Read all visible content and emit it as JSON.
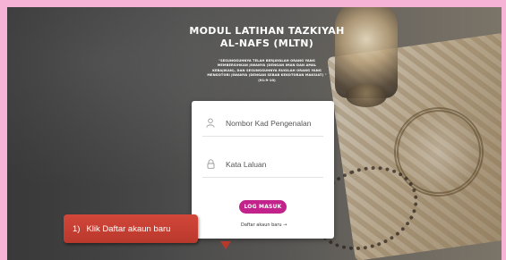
{
  "page": {
    "title_line1": "MODUL LATIHAN TAZKIYAH",
    "title_line2": "AL-NAFS (MLTN)",
    "quote_line1": "\"SESUNGGUHNYA TELAH BERJAYALAH ORANG YANG",
    "quote_line2": "MEMBERSIHKAN JIWANYA (DENGAN IMAN DAN AMAL",
    "quote_line3": "KEBAJIKAN), DAN SESUNGGUHNYA RUGILAH ORANG YANG",
    "quote_line4": "MENGOTORI JIWANYA (DENGAN SEBAB KEKOTORAN MAKSIAT) \"",
    "quote_ref": "(91:9-10)"
  },
  "login": {
    "id_icon": "user-icon",
    "id_placeholder": "Nombor Kad Pengenalan",
    "password_icon": "lock-icon",
    "password_placeholder": "Kata Laluan",
    "login_button": "LOG MASUK",
    "register_link": "Daftar akaun baru →"
  },
  "callout": {
    "number": "1)",
    "text": "Klik Daftar akaun baru"
  },
  "colors": {
    "page_border": "#f7b3d6",
    "button": "#c2238b",
    "callout": "#c43f33"
  }
}
